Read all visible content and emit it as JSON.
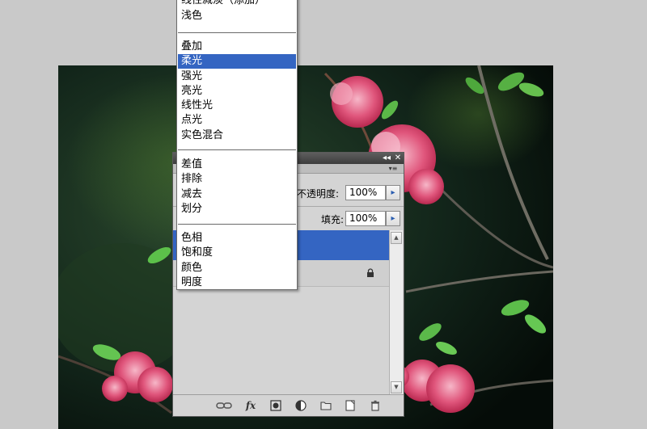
{
  "blend_menu": {
    "items": [
      {
        "label": "线性减淡（添加）",
        "top": 0
      },
      {
        "label": "浅色"
      },
      {
        "label": "叠加"
      },
      {
        "label": "柔光"
      },
      {
        "label": "强光"
      },
      {
        "label": "亮光"
      },
      {
        "label": "线性光"
      },
      {
        "label": "点光"
      },
      {
        "label": "实色混合"
      },
      {
        "label": "差值"
      },
      {
        "label": "排除"
      },
      {
        "label": "减去"
      },
      {
        "label": "划分"
      },
      {
        "label": "色相"
      },
      {
        "label": "饱和度"
      },
      {
        "label": "颜色"
      },
      {
        "label": "明度"
      }
    ],
    "selected": "柔光"
  },
  "layers_panel": {
    "titlebar_collapse": "◂◂",
    "titlebar_close": "✕",
    "panel_menu": "▾≡",
    "opacity_label": "不透明度:",
    "opacity_value": "100%",
    "fill_label": "填充:",
    "fill_value": "100%",
    "arrow": "▸",
    "scroll_up": "▲",
    "scroll_down": "▼"
  },
  "footer_icons": [
    "link-icon",
    "fx-icon",
    "mask-icon",
    "adjustment-icon",
    "folder-icon",
    "new-layer-icon",
    "trash-icon"
  ],
  "footer_labels": {
    "fx": "fx"
  },
  "colors": {
    "selection": "#3465c2",
    "panel_bg": "#d4d4d4",
    "workspace_bg": "#c9c9c9"
  }
}
